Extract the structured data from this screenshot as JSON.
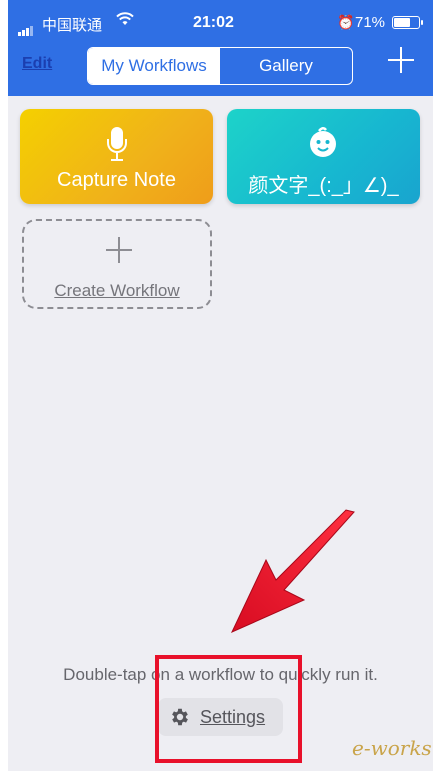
{
  "status_bar": {
    "carrier": "中国联通",
    "time": "21:02",
    "battery_percent": "71%",
    "battery_level": 0.71,
    "icons": [
      "signal-icon",
      "wifi-icon",
      "alarm-icon",
      "battery-icon"
    ]
  },
  "nav": {
    "edit_label": "Edit",
    "tabs": [
      {
        "label": "My Workflows",
        "active": true
      },
      {
        "label": "Gallery",
        "active": false
      }
    ],
    "add_icon": "plus-icon"
  },
  "workflows": [
    {
      "label": "Capture Note",
      "icon": "microphone-icon",
      "color_start": "#f4d000",
      "color_end": "#ef9d1a"
    },
    {
      "label": "颜文字_(:_」∠)_",
      "icon": "baby-face-icon",
      "color_start": "#1dd3c9",
      "color_end": "#19a4cf"
    }
  ],
  "create_workflow": {
    "label": "Create Workflow",
    "icon": "plus-icon"
  },
  "footer": {
    "hint": "Double-tap on a workflow to quickly run it.",
    "settings_label": "Settings",
    "settings_icon": "gear-icon"
  },
  "watermark": "e-works",
  "colors": {
    "accent": "#2f6fe4",
    "background": "#eeeef3",
    "annotation": "#e8102a"
  }
}
